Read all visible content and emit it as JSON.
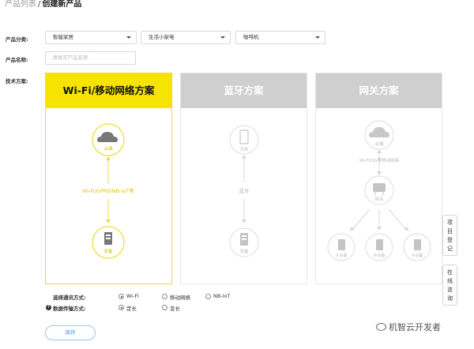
{
  "breadcrumb": {
    "parent": "产品列表",
    "separator": "/",
    "current": "创建新产品"
  },
  "form": {
    "category_label": "产品分类:",
    "category_values": [
      "智能家居",
      "生活小家电",
      "咖啡机"
    ],
    "name_label": "产品名称:",
    "name_placeholder": "请填写产品名称",
    "tech_label": "技术方案:"
  },
  "cards": [
    {
      "title": "Wi-Fi/移动网络方案",
      "selected": true,
      "labels": {
        "top": "云端",
        "middle": "Wi-Fi/GPRS/NB-IoT等",
        "bottom": "设备"
      }
    },
    {
      "title": "蓝牙方案",
      "selected": false,
      "labels": {
        "top": "手机",
        "middle": "蓝牙",
        "bottom": "设备"
      }
    },
    {
      "title": "网关方案",
      "selected": false,
      "labels": {
        "top": "云端",
        "middle": "Wi-Fi/3G等移动网络",
        "hub": "网关",
        "left": "子设备",
        "center": "子设备",
        "right": "子设备"
      }
    }
  ],
  "options": {
    "comm_label": "选择通讯方式:",
    "comm_choices": [
      "Wi-Fi",
      "移动网络",
      "NB-IoT"
    ],
    "comm_selected": "Wi-Fi",
    "data_label": "数据传输方式:",
    "data_choices": [
      "定长",
      "变长"
    ],
    "data_selected": "定长"
  },
  "save_label": "保存",
  "side_tabs": [
    {
      "chars": [
        "项",
        "目",
        "登",
        "记"
      ]
    },
    {
      "chars": [
        "在",
        "线",
        "咨",
        "询"
      ]
    }
  ],
  "watermark": "机智云开发者",
  "colors": {
    "accent_yellow": "#f6e300",
    "inactive_gray": "#cfcfcf",
    "link_blue": "#4a90d9"
  }
}
